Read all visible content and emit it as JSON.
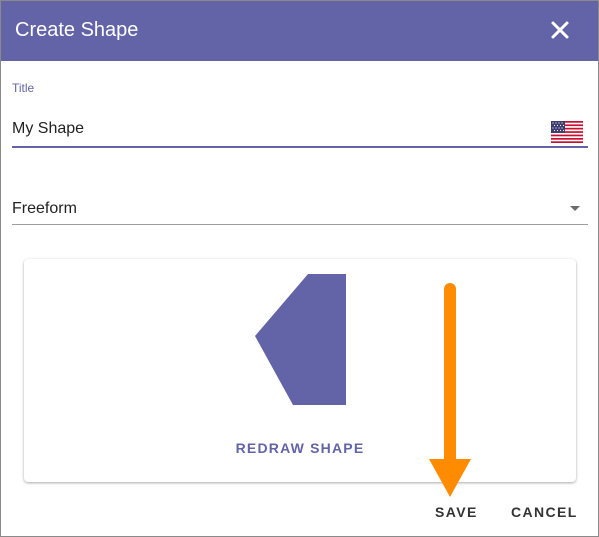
{
  "dialog": {
    "title": "Create Shape",
    "close_icon": "close-icon",
    "header_color": "#6264a7"
  },
  "title_field": {
    "label": "Title",
    "value": "My Shape",
    "flag_icon": "us-flag-icon"
  },
  "shape_type": {
    "selected": "Freeform",
    "arrow_icon": "dropdown-arrow-icon"
  },
  "preview": {
    "shape_color": "#6264a7",
    "redraw_label": "REDRAW SHAPE"
  },
  "annotation": {
    "arrow_color": "#ff8c00"
  },
  "actions": {
    "save_label": "SAVE",
    "cancel_label": "CANCEL"
  }
}
